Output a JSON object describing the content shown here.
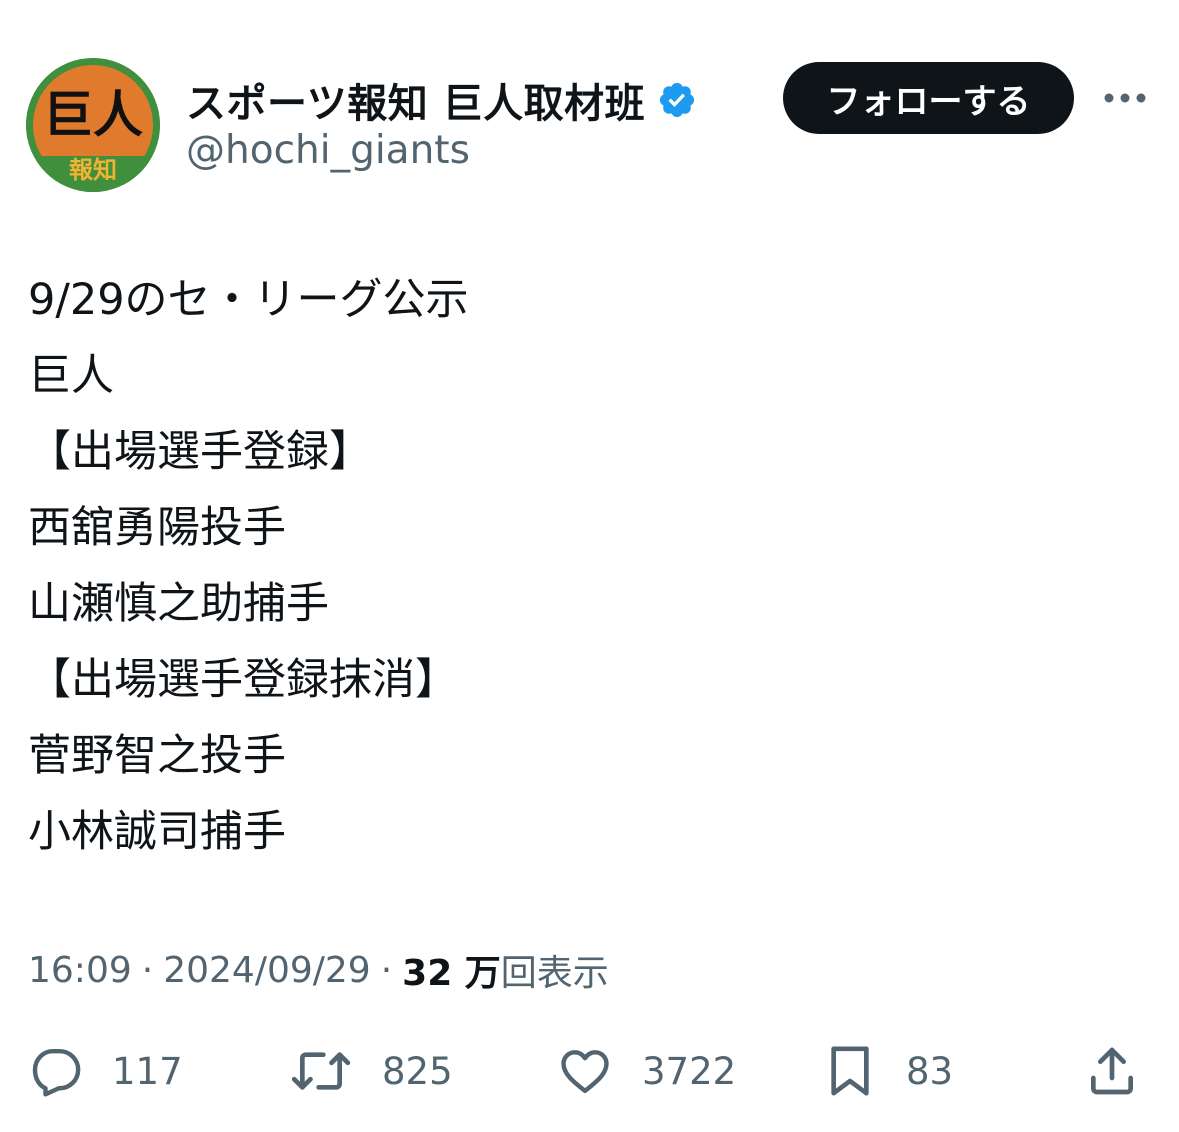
{
  "author": {
    "display_name": "スポーツ報知 巨人取材班",
    "handle": "@hochi_giants",
    "verified_icon": "verified-badge-icon",
    "avatar": {
      "main_text": "巨人",
      "sub_text": "報知",
      "bg_color": "#e07a2c",
      "ring_color": "#3f8f3c"
    }
  },
  "follow_button": {
    "label": "フォローする"
  },
  "more_icon": "more-options-icon",
  "tweet": {
    "lines": [
      "9/29のセ・リーグ公示",
      "巨人",
      "【出場選手登録】",
      "西舘勇陽投手",
      "山瀬慎之助捕手",
      "【出場選手登録抹消】",
      "菅野智之投手",
      "小林誠司捕手"
    ]
  },
  "meta": {
    "time": "16:09",
    "separator": "·",
    "date": "2024/09/29",
    "views_count": "32 万",
    "views_label": "回表示"
  },
  "actions": {
    "replies": {
      "icon": "reply-icon",
      "count": "117"
    },
    "retweets": {
      "icon": "retweet-icon",
      "count": "825"
    },
    "likes": {
      "icon": "like-icon",
      "count": "3722"
    },
    "bookmarks": {
      "icon": "bookmark-icon",
      "count": "83"
    },
    "share": {
      "icon": "share-icon"
    }
  },
  "colors": {
    "text_primary": "#0f1419",
    "text_secondary": "#536471",
    "verified": "#1d9bf0",
    "button_bg": "#0f1419"
  }
}
